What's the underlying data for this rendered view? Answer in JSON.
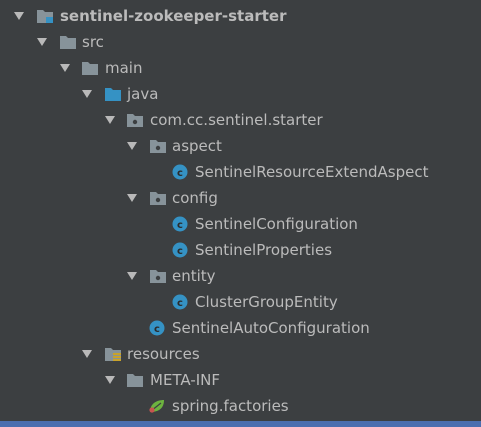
{
  "tree": {
    "root": {
      "label": "sentinel-zookeeper-starter",
      "icon": "module-folder-icon"
    },
    "src": {
      "label": "src",
      "icon": "folder-icon"
    },
    "main": {
      "label": "main",
      "icon": "folder-icon"
    },
    "java": {
      "label": "java",
      "icon": "source-root-folder-icon"
    },
    "package": {
      "label": "com.cc.sentinel.starter",
      "icon": "package-icon"
    },
    "aspect": {
      "label": "aspect",
      "icon": "package-icon"
    },
    "aspect_class": {
      "label": "SentinelResourceExtendAspect",
      "icon": "class-icon"
    },
    "config": {
      "label": "config",
      "icon": "package-icon"
    },
    "config_class1": {
      "label": "SentinelConfiguration",
      "icon": "class-icon"
    },
    "config_class2": {
      "label": "SentinelProperties",
      "icon": "class-icon"
    },
    "entity": {
      "label": "entity",
      "icon": "package-icon"
    },
    "entity_class": {
      "label": "ClusterGroupEntity",
      "icon": "class-icon"
    },
    "auto_config": {
      "label": "SentinelAutoConfiguration",
      "icon": "class-icon"
    },
    "resources": {
      "label": "resources",
      "icon": "resources-folder-icon"
    },
    "meta_inf": {
      "label": "META-INF",
      "icon": "folder-icon"
    },
    "spring_factories": {
      "label": "spring.factories",
      "icon": "spring-leaf-icon"
    }
  },
  "colors": {
    "background": "#3c3f41",
    "text": "#bbbbbb",
    "folder": "#87939a",
    "source_root": "#3592c4",
    "class_badge": "#3592c4",
    "spring": "#6db33f",
    "selection_strip": "#4b6eaf"
  }
}
